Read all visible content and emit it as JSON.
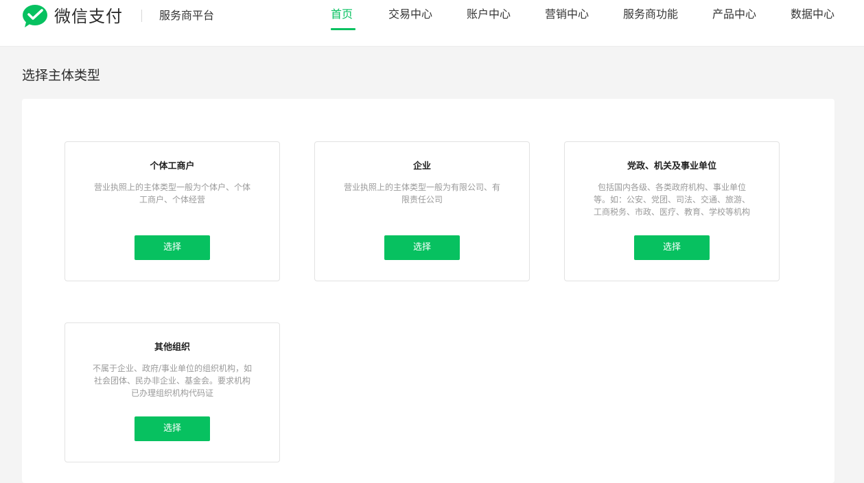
{
  "header": {
    "brand_name": "微信支付",
    "platform_name": "服务商平台",
    "nav": [
      {
        "label": "首页",
        "active": true
      },
      {
        "label": "交易中心",
        "active": false
      },
      {
        "label": "账户中心",
        "active": false
      },
      {
        "label": "营销中心",
        "active": false
      },
      {
        "label": "服务商功能",
        "active": false
      },
      {
        "label": "产品中心",
        "active": false
      },
      {
        "label": "数据中心",
        "active": false
      }
    ],
    "accent_color": "#07c160"
  },
  "main": {
    "title": "选择主体类型",
    "cards": [
      {
        "title": "个体工商户",
        "desc_lines": [
          "营业执照上的主体类型一般为个体户、个体",
          "工商户、个体经营"
        ],
        "button": "选择"
      },
      {
        "title": "企业",
        "desc_lines": [
          "营业执照上的主体类型一般为有限公司、有",
          "限责任公司"
        ],
        "button": "选择"
      },
      {
        "title": "党政、机关及事业单位",
        "desc_lines": [
          "包括国内各级、各类政府机构、事业单位",
          "等。如：公安、党团、司法、交通、旅游、",
          "工商税务、市政、医疗、教育、学校等机构"
        ],
        "button": "选择"
      },
      {
        "title": "其他组织",
        "desc_lines": [
          "不属于企业、政府/事业单位的组织机构，如",
          "社会团体、民办非企业、基金会。要求机构",
          "已办理组织机构代码证"
        ],
        "button": "选择"
      }
    ]
  }
}
